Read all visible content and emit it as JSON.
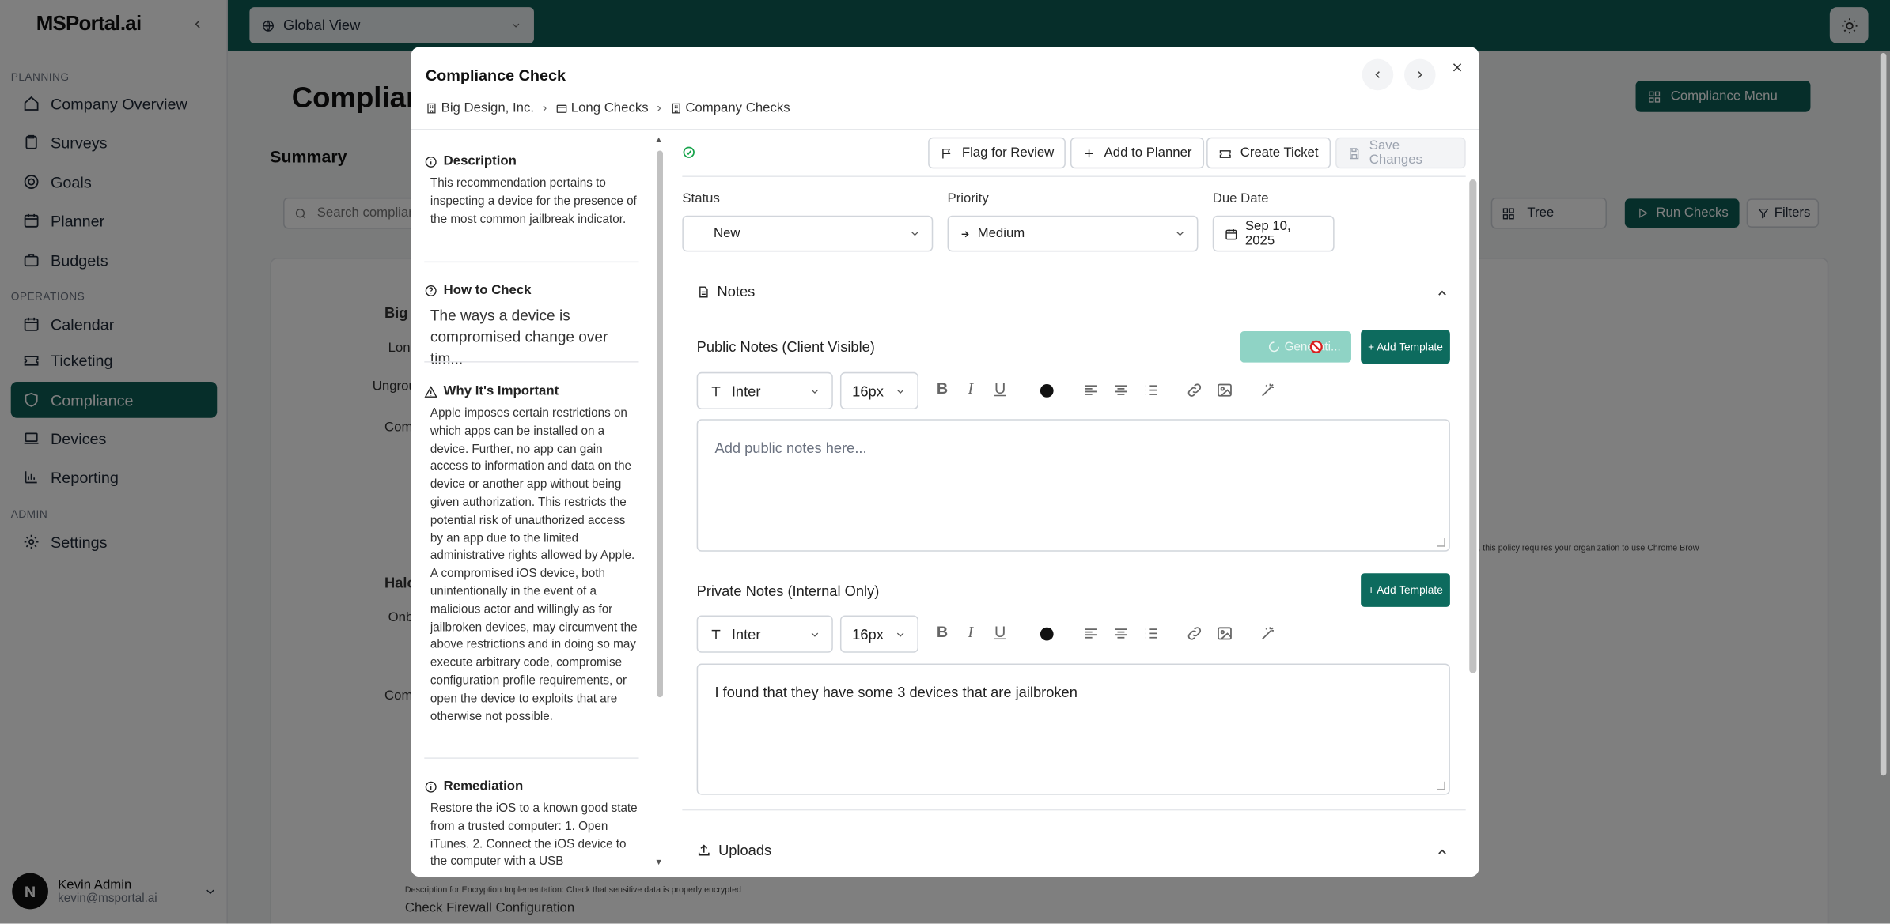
{
  "sidebar": {
    "logo": "MSPortal.ai",
    "sections": [
      {
        "label": "PLANNING"
      },
      {
        "label": "OPERATIONS"
      },
      {
        "label": "ADMIN"
      }
    ],
    "items": [
      {
        "label": "Company Overview",
        "icon": "home-icon"
      },
      {
        "label": "Surveys",
        "icon": "clipboard-icon"
      },
      {
        "label": "Goals",
        "icon": "target-icon"
      },
      {
        "label": "Planner",
        "icon": "calendar-icon"
      },
      {
        "label": "Budgets",
        "icon": "briefcase-icon"
      },
      {
        "label": "Calendar",
        "icon": "calendar-icon"
      },
      {
        "label": "Ticketing",
        "icon": "ticket-icon"
      },
      {
        "label": "Compliance",
        "icon": "shield-icon",
        "active": true
      },
      {
        "label": "Devices",
        "icon": "laptop-icon"
      },
      {
        "label": "Reporting",
        "icon": "chart-icon"
      },
      {
        "label": "Settings",
        "icon": "gear-icon"
      }
    ],
    "user": {
      "initial": "N",
      "name": "Kevin Admin",
      "email": "kevin@msportal.ai"
    }
  },
  "topbar": {
    "view_selector": "Global View"
  },
  "background": {
    "title": "Complian",
    "summary": "Summary",
    "menu": "Compliance Menu",
    "search_placeholder": "Search complian",
    "tree": "Tree",
    "run_checks": "Run Checks",
    "filters": "Filters",
    "rows": [
      "Big",
      "Long",
      "Ungroup",
      "Comp",
      "Halc",
      "Onb",
      "Comp"
    ],
    "footer_desc": "Description for Encryption Implementation: Check that sensitive data is properly encrypted",
    "footer_item": "Check Firewall Configuration",
    "side_note": "s. For Chrome browser, this policy requires your organization to use Chrome Brow"
  },
  "modal": {
    "title": "Compliance Check",
    "breadcrumb": [
      "Big Design, Inc.",
      "Long Checks",
      "Company Checks"
    ],
    "left": {
      "description_title": "Description",
      "description": "This recommendation pertains to inspecting a device for the presence of the most common jailbreak indicator.",
      "how_title": "How to Check",
      "how": "The ways a device is compromised change over tim...",
      "why_title": "Why It's Important",
      "why": "Apple imposes certain restrictions on which apps can be installed on a device. Further, no app can gain access to information and data on the device or another app without being given authorization. This restricts the potential risk of unauthorized access by an app due to the limited administrative rights allowed by Apple. A compromised iOS device, both unintentionally in the event of a malicious actor and willingly as for jailbroken devices, may circumvent the above restrictions and in doing so may execute arbitrary code, compromise configuration profile requirements, or open the device to exploits that are otherwise not possible.",
      "remediation_title": "Remediation",
      "remediation": "Restore the iOS to a known good state from a trusted computer: 1. Open iTunes. 2. Connect the iOS device to the computer with a USB"
    },
    "toolbar": {
      "flag": "Flag for Review",
      "planner": "Add to Planner",
      "ticket": "Create Ticket",
      "save": "Save Changes"
    },
    "fields": {
      "status_label": "Status",
      "status": "New",
      "priority_label": "Priority",
      "priority": "Medium",
      "due_label": "Due Date",
      "due": "Sep 10, 2025"
    },
    "notes": {
      "title": "Notes",
      "public_label": "Public Notes (Client Visible)",
      "generating": "Generati...",
      "add_template": "+ Add Template",
      "font": "Inter",
      "size": "16px",
      "public_placeholder": "Add public notes here...",
      "private_label": "Private Notes (Internal Only)",
      "private_value": "I found that they have some 3 devices that are jailbroken"
    },
    "uploads": {
      "title": "Uploads"
    }
  },
  "colors": {
    "brand": "#0d5c55",
    "accent": "#0d6b5e",
    "generating": "#8fd3c5"
  }
}
